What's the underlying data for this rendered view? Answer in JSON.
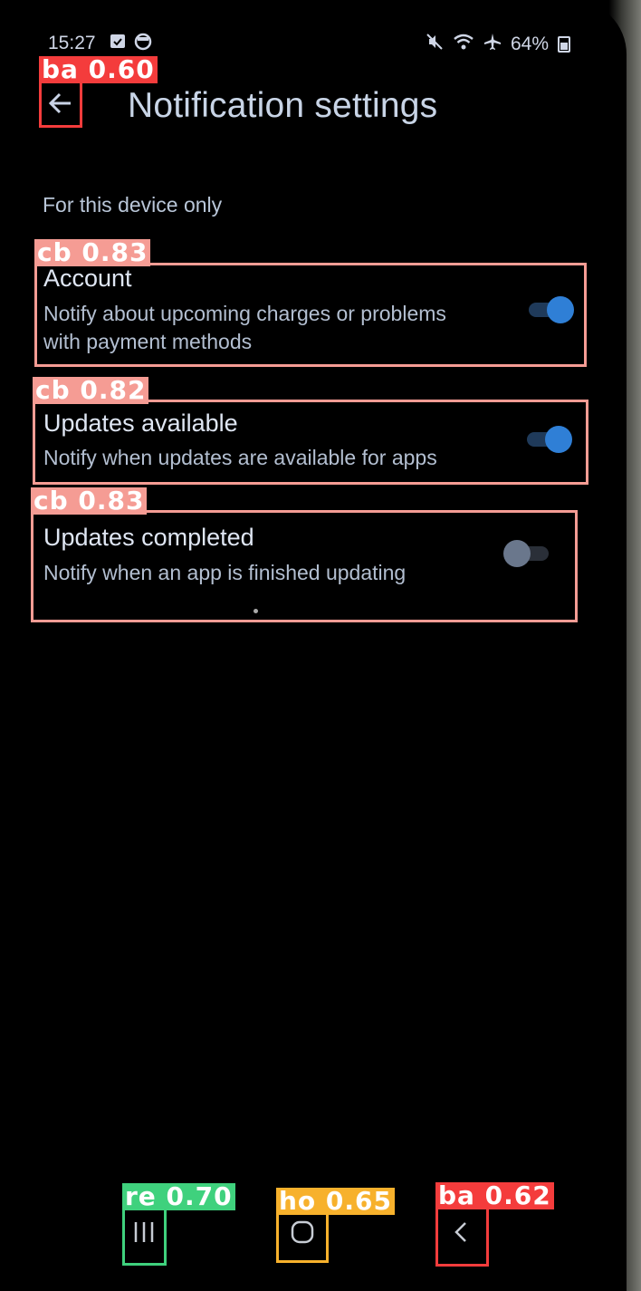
{
  "status_bar": {
    "time": "15:27",
    "battery": "64%"
  },
  "app_bar": {
    "title": "Notification settings"
  },
  "section": {
    "header": "For this device only"
  },
  "settings": [
    {
      "title": "Account",
      "description": "Notify about upcoming charges or problems with payment methods",
      "enabled": true
    },
    {
      "title": "Updates available",
      "description": "Notify when updates are available for apps",
      "enabled": true
    },
    {
      "title": "Updates completed",
      "description": "Notify when an app is finished updating",
      "enabled": false
    }
  ],
  "detections": [
    {
      "label": "ba 0.60",
      "color": "#f43c3c"
    },
    {
      "label": "cb 0.83",
      "color": "#f59c94"
    },
    {
      "label": "cb 0.82",
      "color": "#f59c94"
    },
    {
      "label": "cb 0.83",
      "color": "#f59c94"
    },
    {
      "label": "re 0.70",
      "color": "#3fd17d"
    },
    {
      "label": "ho 0.65",
      "color": "#f7b12c"
    },
    {
      "label": "ba 0.62",
      "color": "#f43c3c"
    }
  ],
  "icons": {
    "back": "arrow-left-icon",
    "recents": "recents-icon",
    "home": "home-icon",
    "nav_back": "chevron-left-icon"
  }
}
